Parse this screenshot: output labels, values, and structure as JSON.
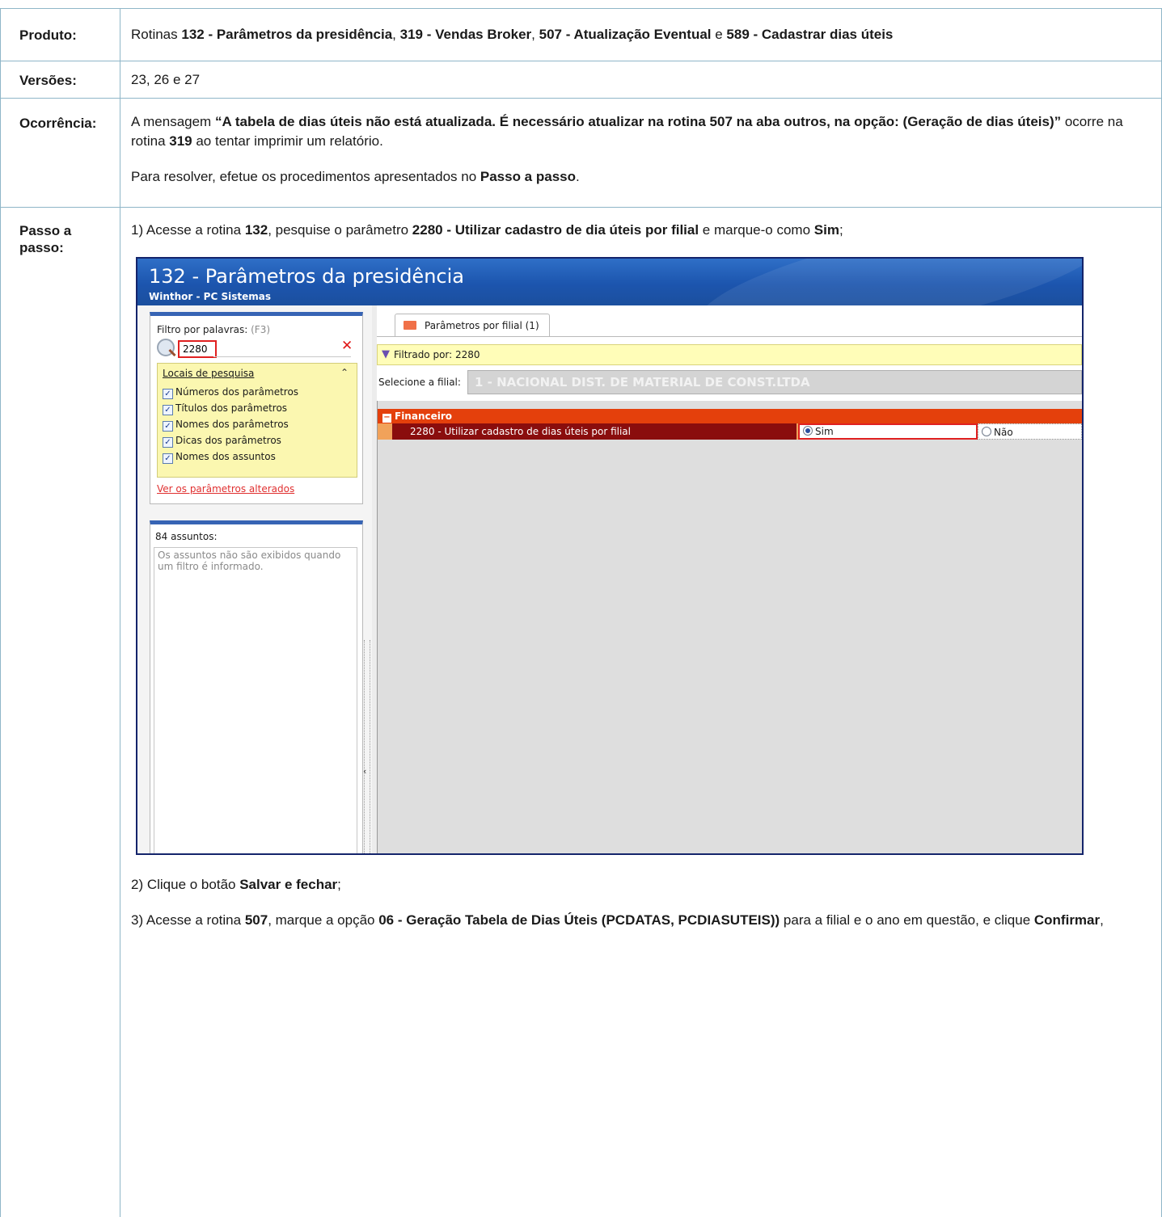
{
  "rows": {
    "produto": {
      "label": "Produto:",
      "t1": "Rotinas ",
      "b1": "132 - Parâmetros da presidência",
      "t2": ", ",
      "b2": "319 - Vendas Broker",
      "t3": ", ",
      "b3": "507 - Atualização Eventual",
      "t4": " e ",
      "b4": "589 - Cadastrar dias úteis"
    },
    "versoes": {
      "label": "Versões:",
      "text": "23, 26 e 27"
    },
    "ocorrencia": {
      "label": "Ocorrência:",
      "t1": "A mensagem ",
      "b1": "“A tabela de dias úteis não está atualizada. É necessário atualizar na rotina 507 na aba outros, na opção: (Geração de dias úteis)”",
      "t2": " ocorre na rotina ",
      "b2": "319",
      "t3": " ao tentar imprimir um relatório.",
      "p2_t1": "Para resolver, efetue os procedimentos apresentados no ",
      "p2_b1": "Passo a passo",
      "p2_t2": "."
    },
    "passo": {
      "label_line1": "Passo a",
      "label_line2": "passo:",
      "step1": {
        "t1": "1) Acesse a rotina ",
        "b1": "132",
        "t2": ", pesquise o parâmetro ",
        "b2": "2280 - Utilizar cadastro de dia úteis por filial",
        "t3": " e marque-o como ",
        "b3": "Sim",
        "t4": ";"
      },
      "step2": {
        "t1": "2) Clique o botão ",
        "b1": "Salvar e fechar",
        "t2": ";"
      },
      "step3": {
        "t1": "3) Acesse a rotina ",
        "b1": "507",
        "t2": ", marque a opção ",
        "b2": "06 - Geração Tabela de Dias Úteis (PCDATAS, PCDIASUTEIS))",
        "t3": " para a filial e o ano em questão, e clique ",
        "b3": "Confirmar",
        "t4": ","
      }
    }
  },
  "screenshot": {
    "title": "132 - Parâmetros da presidência",
    "subtitle": "Winthor - PC Sistemas",
    "filter_label": "Filtro por palavras:",
    "filter_shortcut": "(F3)",
    "search_value": "2280",
    "locais_title": "Locais de pesquisa",
    "checkboxes": [
      "Números dos parâmetros",
      "Títulos dos parâmetros",
      "Nomes dos parâmetros",
      "Dicas dos parâmetros",
      "Nomes dos assuntos"
    ],
    "changed_link": "Ver os parâmetros alterados",
    "assuntos_label": "84 assuntos:",
    "assuntos_note": "Os assuntos não são exibidos quando um filtro é informado.",
    "tab_label": "Parâmetros por filial  (1)",
    "filter_text": "Filtrado por: 2280",
    "filial_label": "Selecione a filial:",
    "filial_value": "1 - NACIONAL DIST. DE MATERIAL DE CONST.LTDA",
    "group": "Financeiro",
    "param_name": "2280 - Utilizar cadastro de dias úteis por filial",
    "option_sim": "Sim",
    "option_nao": "Não"
  }
}
